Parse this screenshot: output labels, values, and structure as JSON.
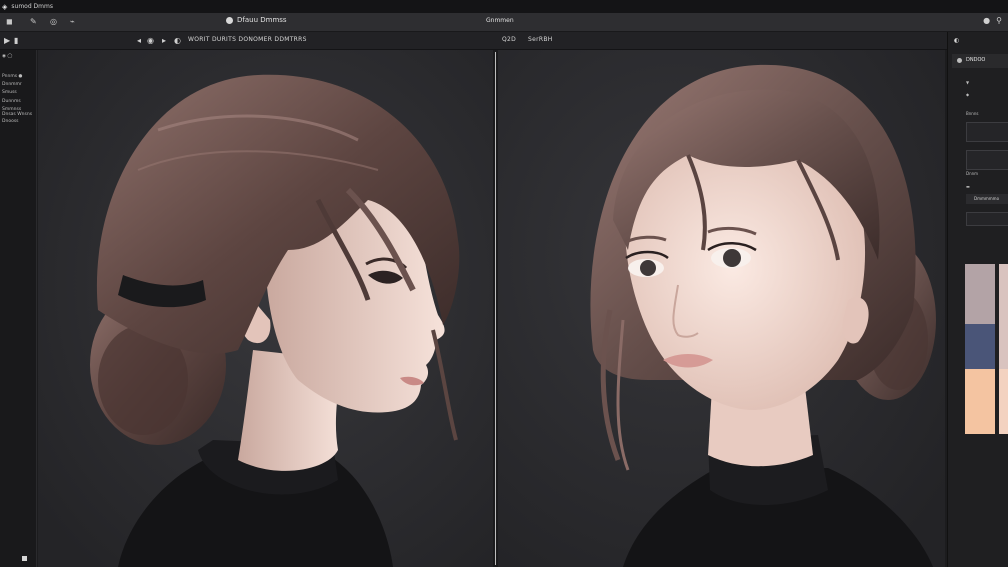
{
  "titlebar": {
    "app_icon": "app-icon",
    "title": "sumod Dmms"
  },
  "menubar": {
    "items": [
      "◼",
      "✎",
      "◎",
      "⌁"
    ],
    "doc_title": "Dfauu Dmmss",
    "center_label": "Gnmmen",
    "right_icons": [
      "●",
      "⚲"
    ]
  },
  "toolbar": {
    "left_tools": [
      "▶",
      "▮"
    ],
    "mid_tools": [
      "◂",
      "◉",
      "▸",
      "◐"
    ],
    "left_label": "WORIT DURITS DONOMER DDMTRRS",
    "right_zoom": "Q2D",
    "right_label": "SerRBH"
  },
  "left_panel": {
    "items": [
      "◉  ◯",
      "Pnnms  ●",
      "Dnnmmr",
      "Smuss",
      "Dunnms",
      "Smmnss",
      "Dnsas Wnsns",
      "Dnooss"
    ]
  },
  "right_panel": {
    "tab_label": "",
    "header_label": "DNDOO",
    "label_1": "Bnnns",
    "label_2": "Dnnm",
    "button_label": "Dmmmmmo",
    "swatch_colors": [
      "#b3a3a6",
      "#4a5578",
      "#f4c4a1"
    ],
    "swatch_right_colors": [
      "#d9c3bf",
      "#f3d2c0"
    ]
  },
  "colors": {
    "hair": "#5b4541",
    "hair_light": "#8a6b66",
    "skin": "#f1d8cf",
    "sweater": "#151517",
    "background": "#2b2b2e"
  }
}
